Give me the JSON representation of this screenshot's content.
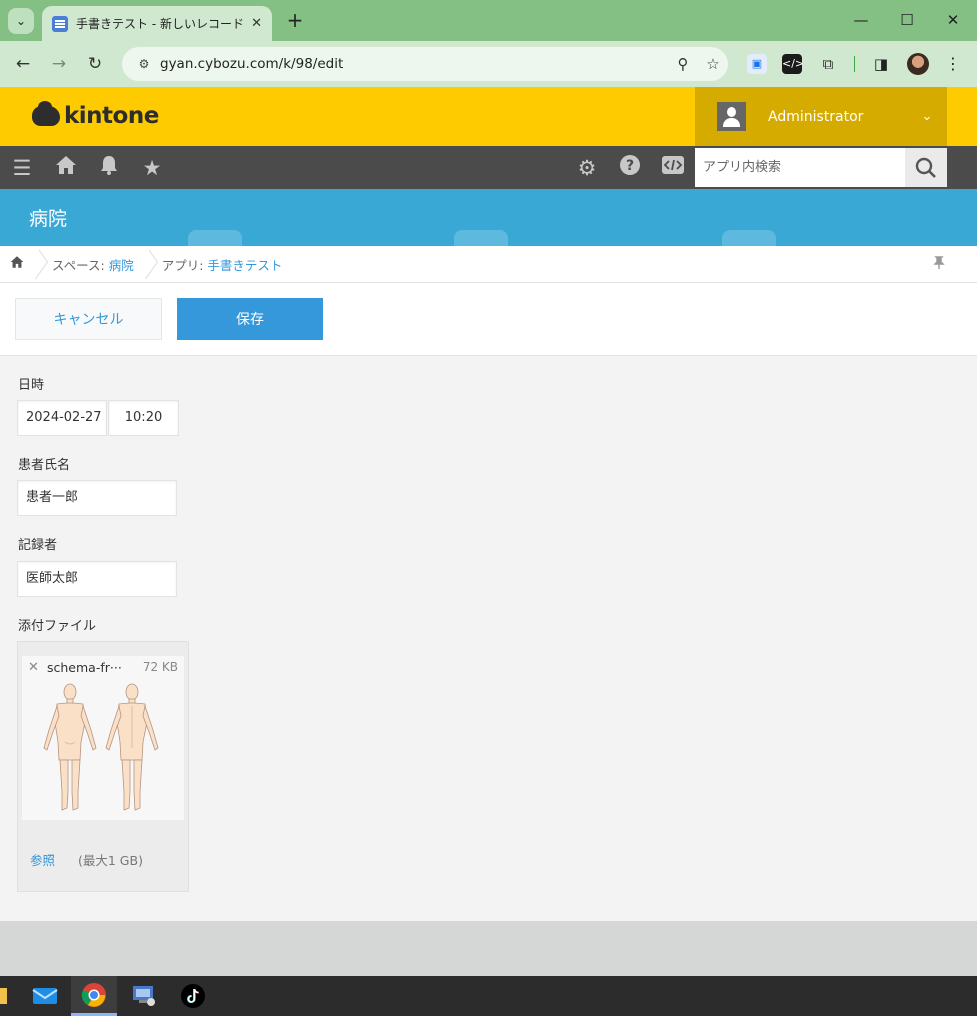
{
  "browser": {
    "tab_title": "手書きテスト - 新しいレコード",
    "url": "gyan.cybozu.com/k/98/edit",
    "colors": {
      "tabstrip": "#84bf84",
      "toolbar": "#cfe8cf"
    }
  },
  "header": {
    "logo_text": "kintone",
    "user_name": "Administrator",
    "colors": {
      "brand": "#fecb00",
      "user_menu": "#d6ab00"
    }
  },
  "nav": {
    "icons": [
      "menu-icon",
      "home-icon",
      "bell-icon",
      "star-icon",
      "gear-icon",
      "help-icon",
      "code-icon"
    ],
    "search_placeholder": "アプリ内検索"
  },
  "space": {
    "name": "病院",
    "color": "#3aa8d5"
  },
  "breadcrumb": {
    "space_prefix": "スペース:",
    "space_name": "病院",
    "app_prefix": "アプリ:",
    "app_name": "手書きテスト"
  },
  "actions": {
    "cancel_label": "キャンセル",
    "save_label": "保存",
    "accent": "#3498db"
  },
  "form": {
    "datetime_label": "日時",
    "date_value": "2024-02-27",
    "time_value": "10:20",
    "patient_label": "患者氏名",
    "patient_value": "患者一郎",
    "recorder_label": "記録者",
    "recorder_value": "医師太郎",
    "attachment_label": "添付ファイル",
    "attachment": {
      "file_name": "schema-fr···",
      "file_size": "72 KB",
      "browse_label": "参照",
      "max_size": "(最大1 GB)"
    }
  },
  "taskbar": {
    "apps": [
      "mail-app-icon",
      "chrome-app-icon",
      "remote-desktop-app-icon",
      "tiktok-app-icon"
    ]
  }
}
